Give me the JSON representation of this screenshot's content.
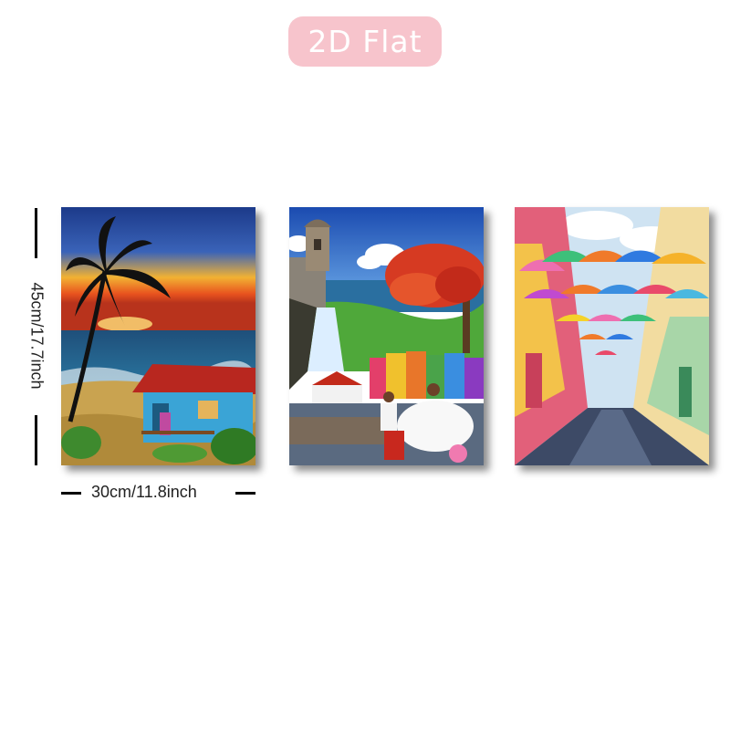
{
  "badge": {
    "label": "2D Flat"
  },
  "dimensions": {
    "height_label": "45cm/17.7inch",
    "width_label": "30cm/11.8inch"
  },
  "panels": [
    {
      "subject": "tropical beach sunset with palm tree and blue house"
    },
    {
      "subject": "fort, waterfall, flamboyan tree, colorful houses and bomba dancers"
    },
    {
      "subject": "colonial street with floating colorful umbrellas"
    }
  ],
  "colors": {
    "badge_bg": "#f7c4cc",
    "badge_text": "#ffffff"
  }
}
